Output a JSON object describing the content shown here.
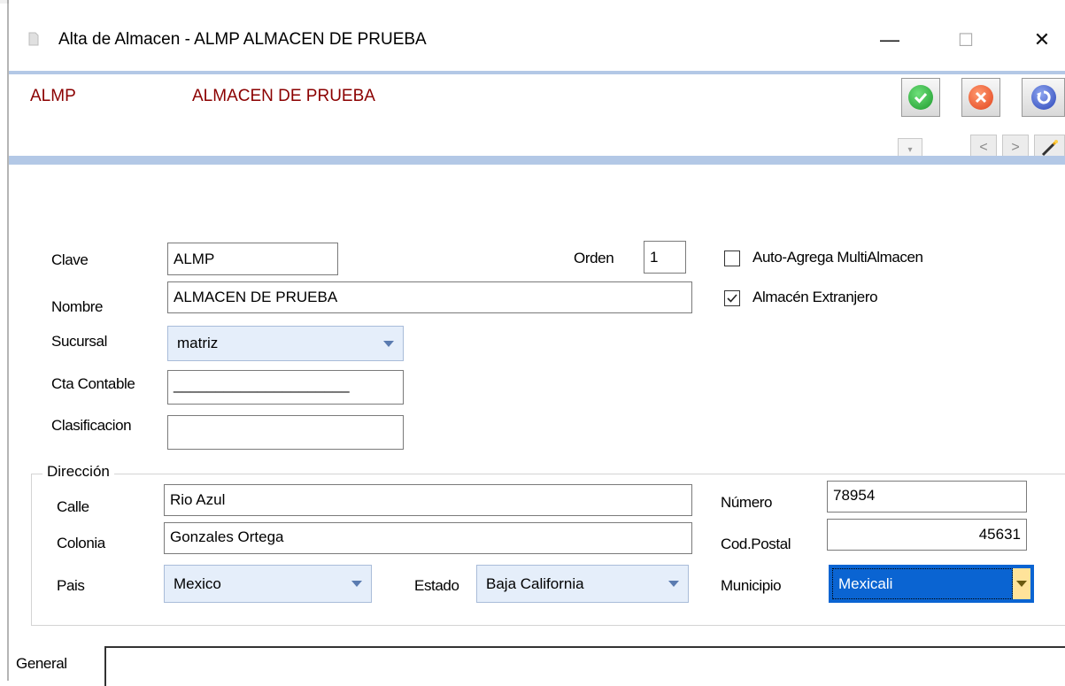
{
  "window": {
    "title": "Alta de Almacen - ALMP ALMACEN DE PRUEBA",
    "minimize_glyph": "—",
    "maximize_glyph": "☐",
    "close_glyph": "✕"
  },
  "header": {
    "code": "ALMP",
    "name": "ALMACEN DE PRUEBA",
    "toolbar": {
      "accept_icon": "check-circle-icon",
      "cancel_icon": "x-circle-icon",
      "undo_icon": "undo-icon",
      "prev_glyph": "<",
      "next_glyph": ">",
      "wand_icon": "magic-wand-icon"
    }
  },
  "form": {
    "clave_label": "Clave",
    "clave_value": "ALMP",
    "orden_label": "Orden",
    "orden_value": "1",
    "nombre_label": "Nombre",
    "nombre_value": "ALMACEN DE PRUEBA",
    "sucursal_label": "Sucursal",
    "sucursal_value": "matriz",
    "cta_label": "Cta Contable",
    "cta_value": "_____________________",
    "clasificacion_label": "Clasificacion",
    "clasificacion_value": "",
    "auto_agrega_label": "Auto-Agrega MultiAlmacen",
    "auto_agrega_checked": false,
    "extranjero_label": "Almacén Extranjero",
    "extranjero_checked": true
  },
  "direccion": {
    "group_title": "Dirección",
    "calle_label": "Calle",
    "calle_value": "Rio Azul",
    "numero_label": "Número",
    "numero_value": "78954",
    "colonia_label": "Colonia",
    "colonia_value": "Gonzales Ortega",
    "cp_label": "Cod.Postal",
    "cp_value": "45631",
    "pais_label": "Pais",
    "pais_value": "Mexico",
    "estado_label": "Estado",
    "estado_value": "Baja California",
    "municipio_label": "Municipio",
    "municipio_value": "Mexicali"
  },
  "tabs": {
    "general_label": "General"
  },
  "colors": {
    "header_text": "#8b0000",
    "separator": "#b3c8e6",
    "selected": "#0a64d2"
  }
}
